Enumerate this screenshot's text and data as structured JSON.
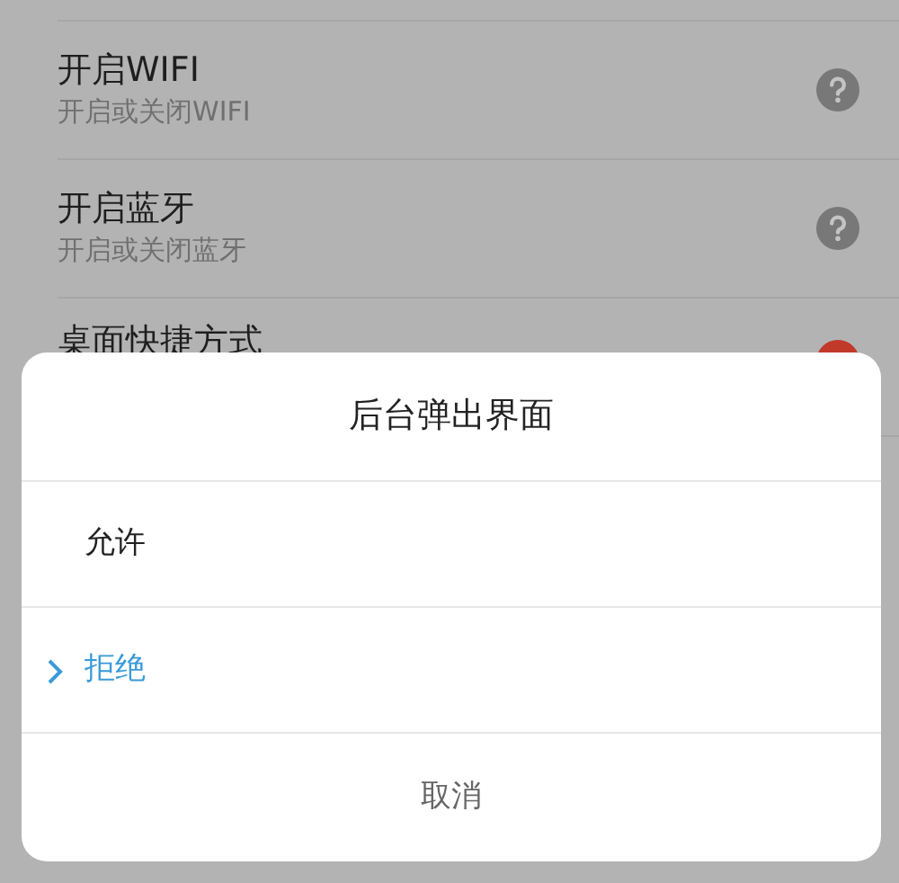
{
  "settings": [
    {
      "title": "开启WIFI",
      "subtitle": "开启或关闭WIFI",
      "kind": "help"
    },
    {
      "title": "开启蓝牙",
      "subtitle": "开启或关闭蓝牙",
      "kind": "help"
    },
    {
      "title": "桌面快捷方式",
      "kind": "status"
    }
  ],
  "dialog": {
    "title": "后台弹出界面",
    "options": [
      {
        "label": "允许",
        "selected": false
      },
      {
        "label": "拒绝",
        "selected": true
      }
    ],
    "cancel": "取消"
  }
}
